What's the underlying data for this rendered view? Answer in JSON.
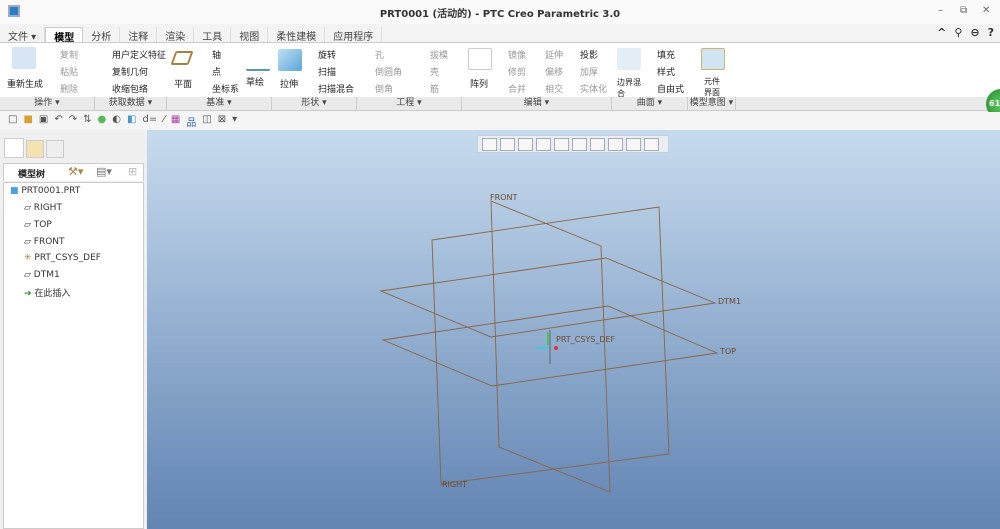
{
  "window": {
    "title": "PRT0001 (活动的) - PTC Creo Parametric 3.0",
    "controls": [
      "–",
      "⧉",
      "✕"
    ]
  },
  "quick_right": [
    "^",
    "⚲",
    "⊖",
    "?"
  ],
  "tabs": [
    "文件 ▾",
    "模型",
    "分析",
    "注释",
    "渲染",
    "工具",
    "视图",
    "柔性建模",
    "应用程序"
  ],
  "active_tab": "模型",
  "ribbon": {
    "regen": "重新生成",
    "copy": "复制",
    "paste": "粘贴",
    "delete": "删除",
    "udf": "用户定义特征",
    "copy_geom": "复制几何",
    "shrinkwrap": "收缩包络",
    "plane": "平面",
    "axis": "轴",
    "point": "点",
    "csys": "坐标系",
    "sketch": "草绘",
    "extrude": "拉伸",
    "revolve": "旋转",
    "sweep": "扫描",
    "swept_blend": "扫描混合",
    "hole": "孔",
    "round": "倒圆角",
    "chamfer": "倒角",
    "draft": "拔模",
    "shell": "壳",
    "rib": "筋",
    "pattern": "阵列",
    "mirror": "镜像",
    "trim": "修剪",
    "merge": "合并",
    "extend": "延伸",
    "offset": "偏移",
    "intersect": "相交",
    "project": "投影",
    "thicken": "加厚",
    "solidify": "实体化",
    "boundary_blend": "边界混合",
    "fill": "填充",
    "style": "样式",
    "freestyle": "自由式",
    "component_interface": "元件界面"
  },
  "groups": [
    "操作 ▾",
    "获取数据 ▾",
    "基准 ▾",
    "形状 ▾",
    "工程 ▾",
    "编辑 ▾",
    "曲面 ▾",
    "模型意图 ▾"
  ],
  "model_tree": {
    "title": "模型树",
    "items": [
      "PRT0001.PRT",
      "RIGHT",
      "TOP",
      "FRONT",
      "PRT_CSYS_DEF",
      "DTM1",
      "在此插入"
    ]
  },
  "viewport": {
    "labels": {
      "front": "FRONT",
      "dtm1": "DTM1",
      "top": "TOP",
      "right": "RIGHT",
      "csys": "PRT_CSYS_DEF"
    },
    "datum_color": "#8a6440"
  },
  "badge": "61"
}
